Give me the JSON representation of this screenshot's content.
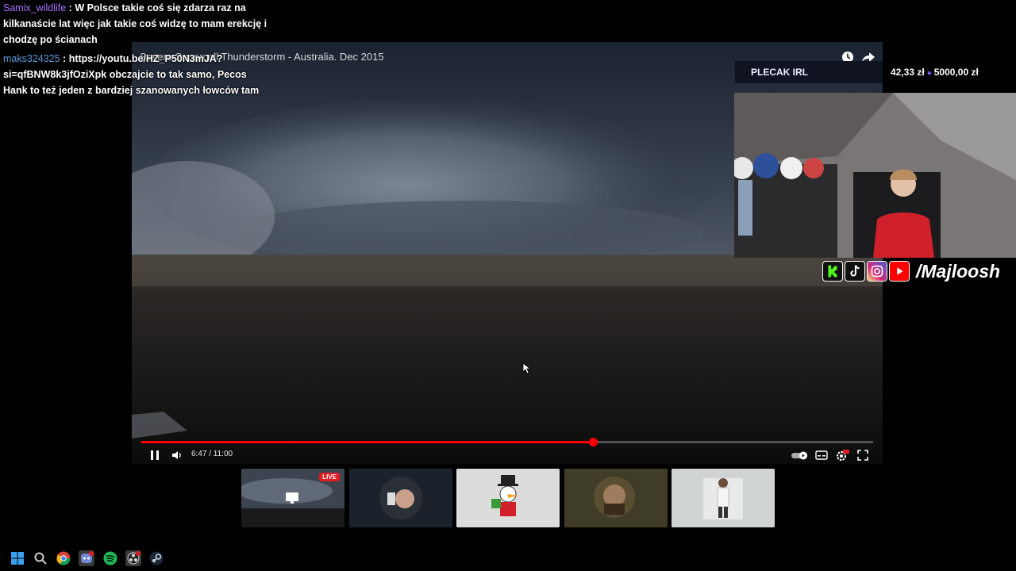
{
  "chat": {
    "messages": [
      {
        "user": "Samix_wildlife",
        "user_color": "#a970ff",
        "text": "W Polsce takie coś się zdarza raz na kilkanaście lat więc jak takie coś widzę to mam erekcję i chodzę po ścianach"
      },
      {
        "user": "maks324325",
        "user_color": "#5b9bd5",
        "text": "https://youtu.be/HZ_P50N3mJA?si=qfBNW8k3jfOziXpk obczajcie to tak samo, Pecos Hank to też jeden z bardziej szanowanych łowców tam"
      }
    ]
  },
  "player": {
    "title": "Severe Supercell Thunderstorm - Australia. Dec 2015",
    "time_display": "6:47 / 11:00",
    "progress": 0.617,
    "icons": {
      "watch_later": "clock-icon",
      "share": "share-icon",
      "play_pause": "pause-icon",
      "volume": "volume-icon",
      "autoplay": "autoplay-toggle-icon",
      "subtitles": "subtitles-icon",
      "settings": "settings-gear-icon",
      "fullscreen": "fullscreen-icon"
    }
  },
  "panel": {
    "title": "PLECAK IRL",
    "goal_current": "42,33 zł",
    "goal_target": "5000,00 zł"
  },
  "socials": {
    "handle": "/Majloosh",
    "icons": [
      "kick-icon",
      "tiktok-icon",
      "instagram-icon",
      "youtube-icon"
    ]
  },
  "thumbnails": {
    "live_label": "LIVE",
    "items": [
      "storm-stream-thumbnail",
      "man-drinking-thumbnail",
      "scrooge-mcduck-thumbnail",
      "bearded-man-thumbnail",
      "white-room-thumbnail"
    ]
  },
  "taskbar": {
    "icons": [
      "windows-start-icon",
      "search-icon",
      "chrome-icon",
      "discord-icon",
      "spotify-icon",
      "obs-icon",
      "steam-icon"
    ]
  },
  "colors": {
    "progress_red": "#ff0000",
    "live_red": "#e01b24",
    "goal_accent": "#6b5cff",
    "panel_bg": "#0f1420"
  }
}
